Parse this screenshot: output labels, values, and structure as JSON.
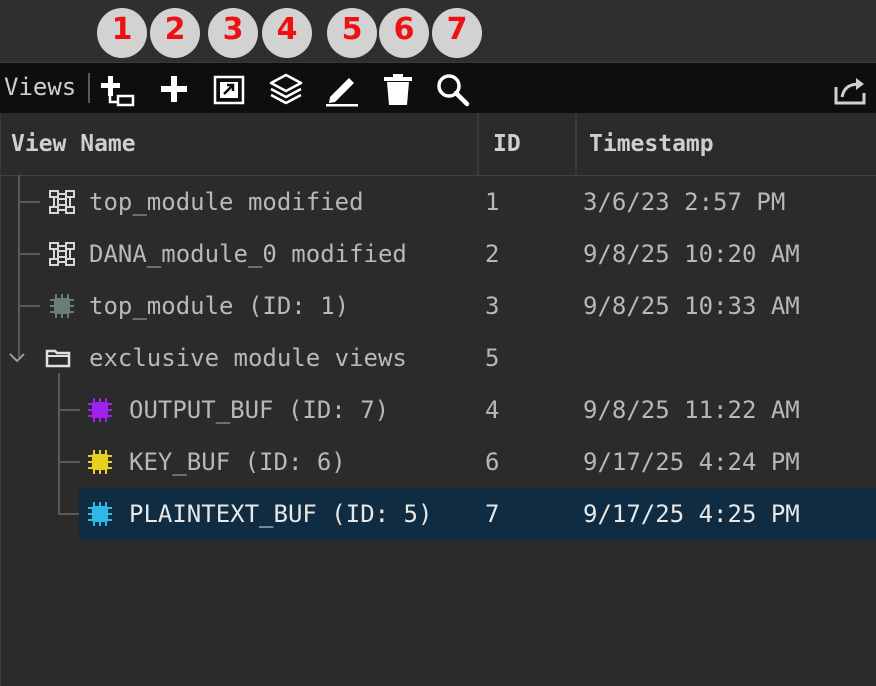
{
  "callouts": [
    "1",
    "2",
    "3",
    "4",
    "5",
    "6",
    "7"
  ],
  "toolbar": {
    "title": "Views",
    "icons": [
      "add-child-view-icon",
      "plus-icon",
      "open-external-icon",
      "layers-icon",
      "pencil-icon",
      "trash-icon",
      "search-icon"
    ],
    "right_icon": "export-icon"
  },
  "columns": {
    "name": "View Name",
    "id": "ID",
    "timestamp": "Timestamp"
  },
  "rows": [
    {
      "name": "top_module modified",
      "id": "1",
      "timestamp": "3/6/23 2:57 PM",
      "icon": "schematic-icon"
    },
    {
      "name": "DANA_module_0 modified",
      "id": "2",
      "timestamp": "9/8/25 10:20 AM",
      "icon": "schematic-icon"
    },
    {
      "name": "top_module (ID: 1)",
      "id": "3",
      "timestamp": "9/8/25 10:33 AM",
      "icon": "chip-icon",
      "color": "#6b7b78"
    },
    {
      "name": "exclusive module views",
      "id": "5",
      "timestamp": "",
      "icon": "folder-icon",
      "expanded": true
    },
    {
      "name": "OUTPUT_BUF (ID: 7)",
      "id": "4",
      "timestamp": "9/8/25 11:22 AM",
      "icon": "chip-icon",
      "color": "#a020f0"
    },
    {
      "name": "KEY_BUF (ID: 6)",
      "id": "6",
      "timestamp": "9/17/25 4:24 PM",
      "icon": "chip-icon",
      "color": "#e8d020"
    },
    {
      "name": "PLAINTEXT_BUF (ID: 5)",
      "id": "7",
      "timestamp": "9/17/25 4:25 PM",
      "icon": "chip-icon",
      "color": "#30b8e8",
      "selected": true
    }
  ]
}
